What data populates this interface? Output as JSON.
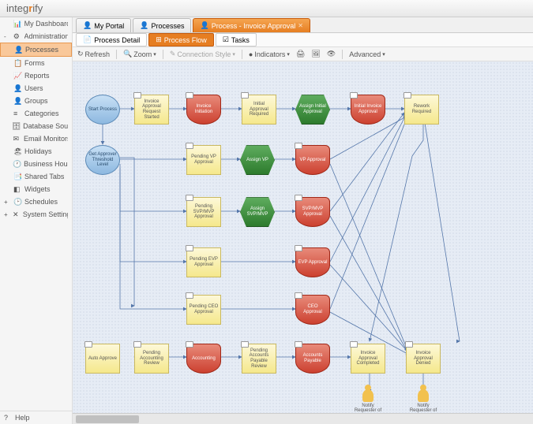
{
  "brand": {
    "part1": "integ",
    "part2": "r",
    "part3": "ify"
  },
  "sidebar": {
    "items": [
      {
        "icon": "📊",
        "label": "My Dashboard"
      },
      {
        "icon": "⚙",
        "label": "Administration",
        "expand": "-"
      },
      {
        "icon": "👤",
        "label": "Processes",
        "active": true
      },
      {
        "icon": "📋",
        "label": "Forms"
      },
      {
        "icon": "📈",
        "label": "Reports"
      },
      {
        "icon": "👤",
        "label": "Users"
      },
      {
        "icon": "👤",
        "label": "Groups"
      },
      {
        "icon": "≡",
        "label": "Categories"
      },
      {
        "icon": "🗄",
        "label": "Database Sources"
      },
      {
        "icon": "✉",
        "label": "Email Monitors"
      },
      {
        "icon": "🏖",
        "label": "Holidays"
      },
      {
        "icon": "🕐",
        "label": "Business Hours"
      },
      {
        "icon": "📑",
        "label": "Shared Tabs"
      },
      {
        "icon": "◧",
        "label": "Widgets"
      },
      {
        "icon": "🕑",
        "label": "Schedules",
        "expand": "+"
      },
      {
        "icon": "✕",
        "label": "System Settings",
        "expand": "+"
      }
    ],
    "help": {
      "icon": "?",
      "label": "Help"
    }
  },
  "tabs": [
    {
      "icon": "👤",
      "label": "My Portal"
    },
    {
      "icon": "👤",
      "label": "Processes"
    },
    {
      "icon": "👤",
      "label": "Process - Invoice Approval",
      "active": true,
      "closable": true
    }
  ],
  "subtabs": [
    {
      "icon": "📄",
      "label": "Process Detail"
    },
    {
      "icon": "⊞",
      "label": "Process Flow",
      "active": true
    },
    {
      "icon": "☑",
      "label": "Tasks"
    }
  ],
  "toolbar": {
    "refresh": "Refresh",
    "zoom": "Zoom",
    "connection": "Connection Style",
    "indicators": "Indicators",
    "advanced": "Advanced"
  },
  "nodes": {
    "start": "Start Process",
    "reqStarted": "Invoice Approval Request Started",
    "initiation": "Invoice Initiation",
    "initReq": "Initial Approval Required",
    "assignInit": "Assign Initial Approval",
    "initInvoice": "Initial Invoice Approval",
    "rework": "Rework Required",
    "getLevel": "Get Approver Threshold Level",
    "pendVP": "Pending VP Approval",
    "assignVP": "Assign VP",
    "vpApp": "VP Approval",
    "pendSVP": "Pending SVP/MVP Approval",
    "assignSVP": "Assign SVP/MVP",
    "svpApp": "SVP/MVP Approval",
    "pendEVP": "Pending EVP Approval",
    "evpApp": "EVP Approval",
    "pendCEO": "Pending CEO Approval",
    "ceoApp": "CEO Approval",
    "autoApp": "Auto Approve",
    "pendAcct": "Pending Accounting Review",
    "acct": "Accounting",
    "pendAP": "Pending Accounts Payable Review",
    "ap": "Accounts Payable",
    "completed": "Invoice Approval Completed",
    "denied": "Invoice Approval Denied",
    "notifyApp": "Notify Requester of Invoice Approval",
    "notifyDen": "Notify Requester of Invoice Denial"
  }
}
